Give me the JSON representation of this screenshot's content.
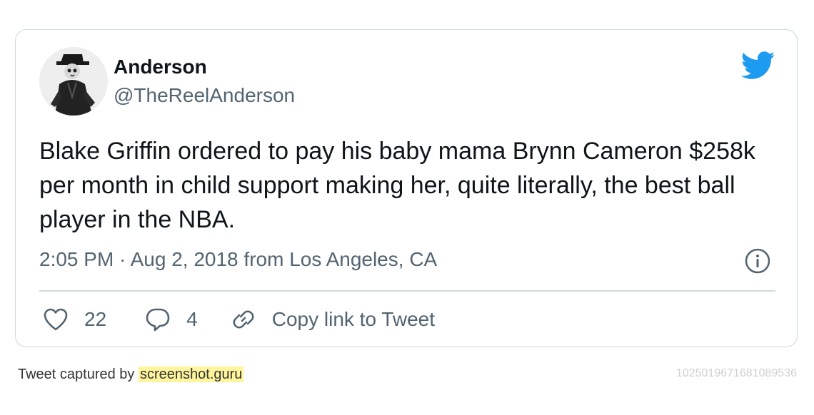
{
  "tweet": {
    "display_name": "Anderson",
    "handle": "@TheReelAnderson",
    "text": "Blake Griffin ordered to pay his baby mama Brynn Cameron $258k per month in child support making her, quite literally, the best ball player in the NBA.",
    "timestamp": "2:05 PM · Aug 2, 2018 from Los Angeles, CA",
    "likes": "22",
    "replies": "4",
    "copy_link_label": "Copy link to Tweet"
  },
  "footer": {
    "captured_prefix": "Tweet captured by ",
    "captured_site": "screenshot.guru",
    "tweet_id": "1025019671681089536"
  },
  "icons": {
    "brand": "twitter-bird-icon",
    "info": "info-icon",
    "like": "heart-icon",
    "reply": "reply-bubble-icon",
    "copy": "link-icon"
  },
  "colors": {
    "brand": "#1d9bf0",
    "text": "#0f1419",
    "secondary": "#536471",
    "border": "#cfd9de",
    "highlight": "#fff59d"
  }
}
